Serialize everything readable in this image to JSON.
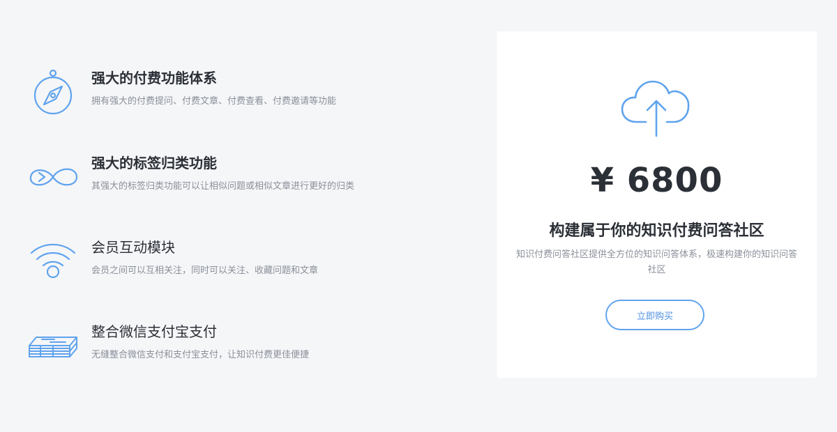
{
  "features": [
    {
      "title": "强大的付费功能体系",
      "description": "拥有强大的付费提问、付费文章、付费查看、付费邀请等功能",
      "icon": "compass-icon"
    },
    {
      "title": "强大的标签归类功能",
      "description": "其强大的标签归类功能可以让相似问题或相似文章进行更好的归类",
      "icon": "infinity-icon"
    },
    {
      "title": "会员互动模块",
      "description": "会员之间可以互相关注，同时可以关注、收藏问题和文章",
      "icon": "wifi-icon"
    },
    {
      "title": "整合微信支付宝支付",
      "description": "无缝整合微信支付和支付宝支付，让知识付费更佳便捷",
      "icon": "money-stack-icon"
    }
  ],
  "pricing": {
    "icon": "cloud-upload-icon",
    "price": "¥ 6800",
    "headline": "构建属于你的知识付费问答社区",
    "description": "知识付费问答社区提供全方位的知识问答体系，极速构建你的知识问答社区",
    "buy_label": "立即购买"
  },
  "colors": {
    "accent": "#5fa3ee",
    "background": "#f5f6f8",
    "card": "#ffffff",
    "title": "#2b2f36",
    "muted": "#8a8f99"
  }
}
